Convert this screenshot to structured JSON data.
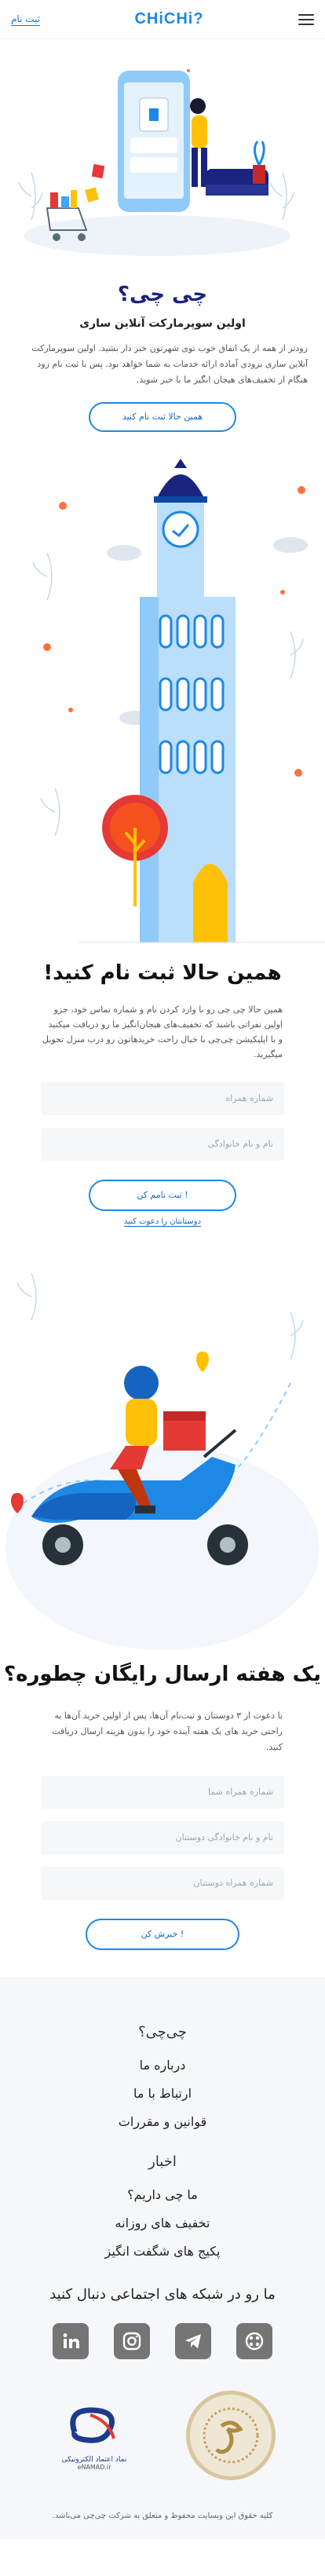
{
  "header": {
    "signup_link": "ثبت نام",
    "logo_text": "CHiCHi?",
    "menu_icon": "hamburger-icon"
  },
  "hero": {
    "title": "چی چی؟",
    "subtitle": "اولین سوپرمارکت آنلاین ساری",
    "description": "زودتر از همه از یک اتفاق خوب توی شهرتون خبر دار بشید. اولین سوپرمارکت آنلاین ساری بزودی آماده ارائه خدمات به شما خواهد بود. پس با ثبت نام زود هنگام از تخفیف‌های هیجان انگیز ما با خبر شوید.",
    "cta": "همین حالا ثبت نام کنید"
  },
  "signup": {
    "title": "همین حالا ثبت نام کنید!",
    "description": "همین حالا چی چی رو با وارد کردن نام و شماره تماس خود، جزو اولین نفراتی باشید که تخفیف‌های هیجان‌انگیز ما رو دریافت میکنید و با اپلیکیشن چی‌چی با خیال راحت خریدهاتون رو درب منزل تحویل میگیرید.",
    "phone_placeholder": "شماره همراه",
    "name_placeholder": "نام و نام خانوادگی",
    "submit": "ثبت نامم کن !",
    "invite_link": "دوستانتان را دعوت کنید"
  },
  "invite": {
    "title": "یک هفته ارسال رایگان چطوره؟",
    "description": "با دعوت از ۳ دوستتان و ثبت‌نام آن‌ها، پس از اولین خرید آن‌ها به راحتی خرید های یک هفته آینده خود را بدون هزینه ارسال دریافت کنید.",
    "your_phone_placeholder": "شماره همراه شما",
    "friend_name_placeholder": "نام و نام خانوادگی دوستتان",
    "friend_phone_placeholder": "شماره همراه دوستتان",
    "submit": "خبرش کن !"
  },
  "footer": {
    "group1_title": "چی‌چی؟",
    "group1_items": [
      "درباره ما",
      "ارتباط با ما",
      "قوانین و مقررات"
    ],
    "group2_title": "اخبار",
    "group2_items": [
      "ما چی داریم؟",
      "تخفیف های روزانه",
      "پکیج های شگفت انگیز"
    ],
    "social_title": "ما رو در شبکه های اجتماعی دنبال کنید",
    "social_icons": [
      "linkedin-icon",
      "instagram-icon",
      "telegram-icon",
      "aparat-icon"
    ],
    "enamad_text": "نماد اعتماد الکترونیکی",
    "enamad_sub": "eNAMAD.ir",
    "copyright": "کلیه حقوق این وبسایت محفوظ و متعلق به شرکت چی‌چی‌ می‌باشد."
  },
  "colors": {
    "primary": "#1e88e5",
    "dark_blue": "#1a237e",
    "accent_yellow": "#ffc107",
    "accent_red": "#e53935"
  }
}
